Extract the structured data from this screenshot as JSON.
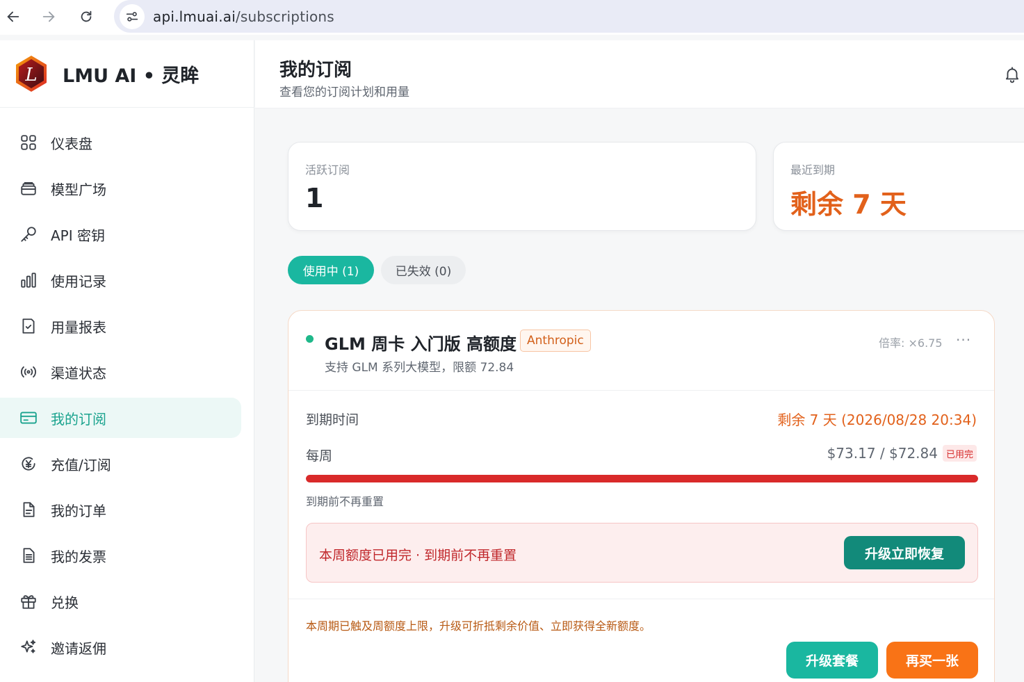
{
  "browser": {
    "url_host": "api.lmuai.ai",
    "url_path": "/subscriptions"
  },
  "brand": {
    "name": "LMU AI • 灵眸",
    "logo_letter": "L"
  },
  "sidebar": {
    "items": [
      {
        "label": "仪表盘",
        "icon": "dashboard-grid-icon"
      },
      {
        "label": "模型广场",
        "icon": "model-stack-icon"
      },
      {
        "label": "API 密钥",
        "icon": "key-icon"
      },
      {
        "label": "使用记录",
        "icon": "bar-chart-icon"
      },
      {
        "label": "用量报表",
        "icon": "clipboard-check-icon"
      },
      {
        "label": "渠道状态",
        "icon": "broadcast-icon"
      },
      {
        "label": "我的订阅",
        "icon": "credit-card-icon",
        "active": true
      },
      {
        "label": "充值/订阅",
        "icon": "yen-circle-icon"
      },
      {
        "label": "我的订单",
        "icon": "document-icon"
      },
      {
        "label": "我的发票",
        "icon": "invoice-icon"
      },
      {
        "label": "兑换",
        "icon": "gift-icon"
      },
      {
        "label": "邀请返佣",
        "icon": "sparkles-icon"
      }
    ]
  },
  "header": {
    "title": "我的订阅",
    "subtitle": "查看您的订阅计划和用量"
  },
  "stats": {
    "active_label": "活跃订阅",
    "active_value": "1",
    "expiry_label": "最近到期",
    "expiry_value": "剩余 7 天"
  },
  "tabs": {
    "active": "使用中 (1)",
    "expired": "已失效 (0)"
  },
  "subscription": {
    "name": "GLM 周卡 入门版 高额度",
    "provider": "Anthropic",
    "description": "支持 GLM 系列大模型，限额 72.84",
    "rate": "倍率: ×6.75",
    "more": "···",
    "expire_label": "到期时间",
    "expire_value": "剩余 7 天 (2026/08/28 20:34)",
    "usage_label": "每周",
    "usage_value": "$73.17 / $72.84",
    "usage_fraction": 1.0,
    "used_badge": "已用完",
    "reset_note": "到期前不再重置",
    "alert_text": "本周额度已用完 · 到期前不再重置",
    "restore_button": "升级立即恢复",
    "hint": "本周期已触及周额度上限，升级可折抵剩余价值、立即获得全新额度。",
    "upgrade_button": "升级套餐",
    "rebuy_button": "再买一张"
  },
  "colors": {
    "accent": "#1ab7a0",
    "warning": "#e2611b",
    "danger": "#d92a2a",
    "orange_button": "#f97316"
  }
}
